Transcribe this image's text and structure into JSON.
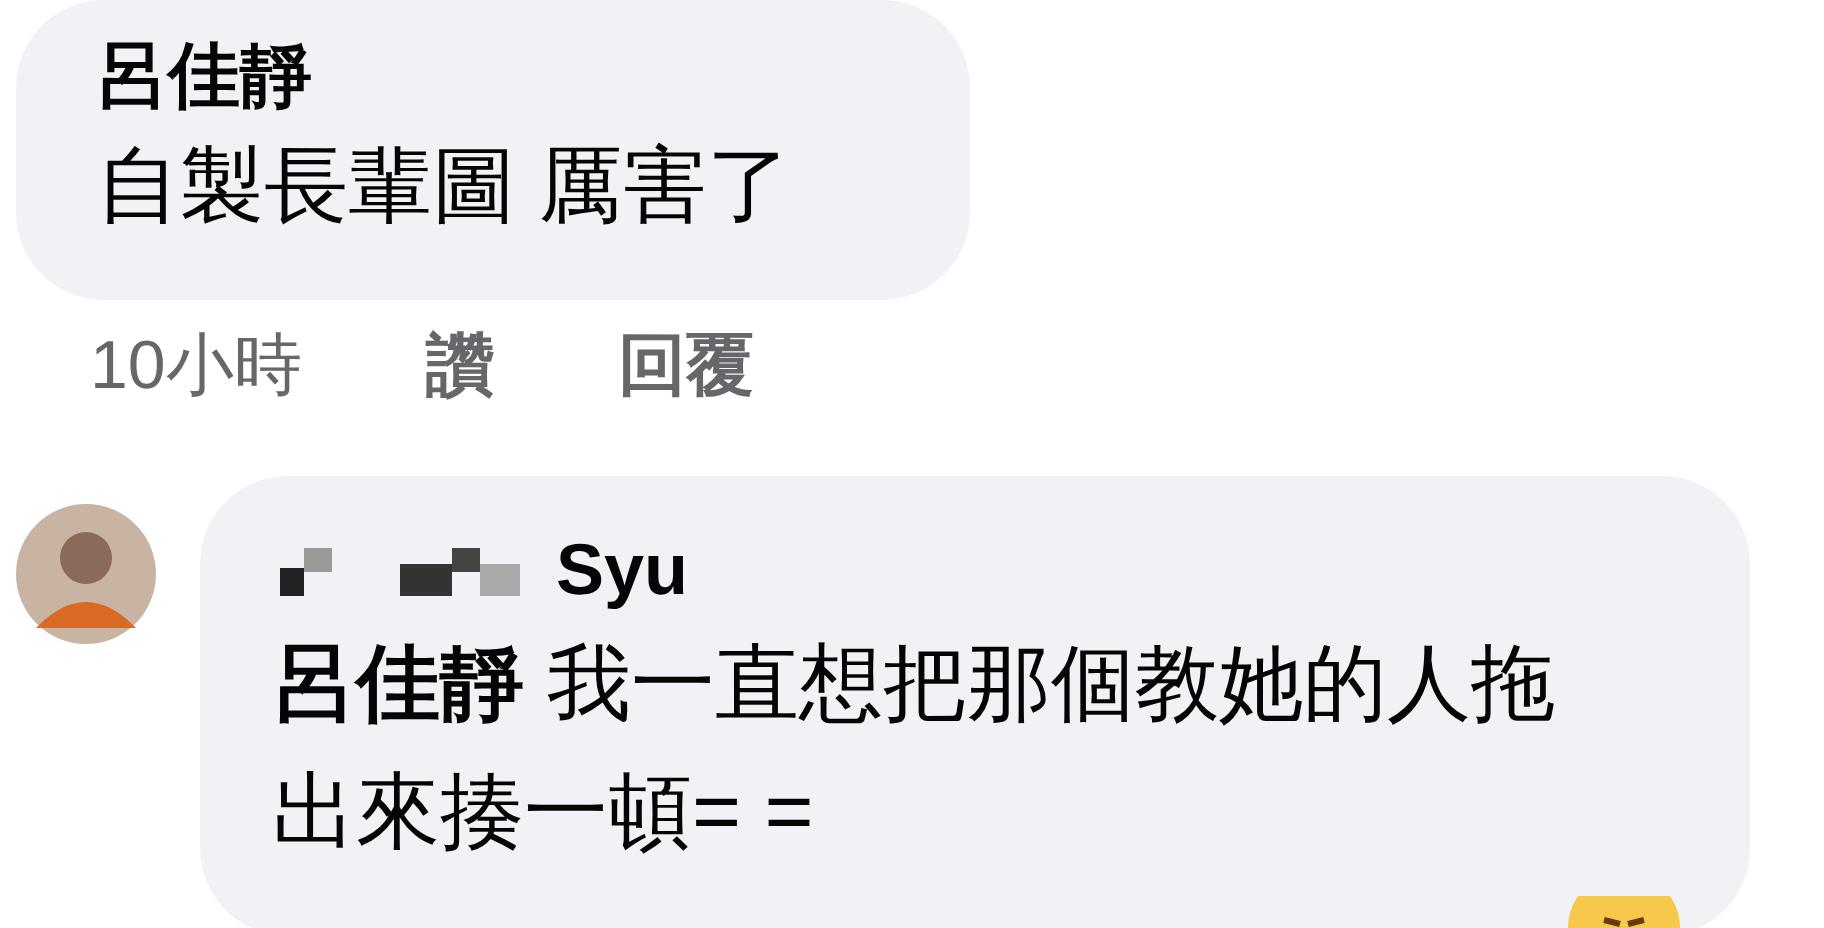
{
  "comments": [
    {
      "author": "呂佳靜",
      "text": "自製長輩圖 厲害了",
      "time": "10小時",
      "actions": [
        "讚",
        "回覆"
      ]
    },
    {
      "author": "Syu",
      "text": "**呂佳靜** 我一直想把那個教她的人拖出來揍一頓= ="
    }
  ]
}
